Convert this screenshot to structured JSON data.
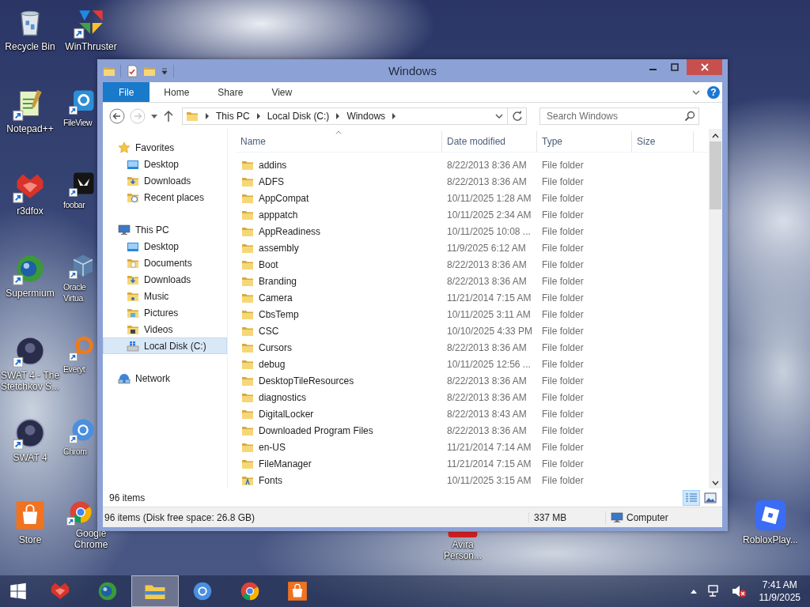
{
  "desktop": {
    "icons": [
      {
        "label": "Recycle Bin",
        "kind": "recycle",
        "shortcut": false
      },
      {
        "label": "Notepad++",
        "kind": "notepad",
        "shortcut": true
      },
      {
        "label": "r3dfox",
        "kind": "fox",
        "shortcut": true
      },
      {
        "label": "Supermium",
        "kind": "globe",
        "shortcut": true
      },
      {
        "label": "SWAT 4 - The Stetchkov S...",
        "kind": "portrait",
        "shortcut": true
      },
      {
        "label": "SWAT 4",
        "kind": "portrait",
        "shortcut": true
      },
      {
        "label": "Store",
        "kind": "store",
        "shortcut": false
      },
      {
        "label": "WinThruster",
        "kind": "winthruster",
        "shortcut": true
      },
      {
        "label": "FileView",
        "kind": "viewer",
        "shortcut": true
      },
      {
        "label": "foobar",
        "kind": "foobar",
        "shortcut": true
      },
      {
        "label": "Oracle Virtua",
        "kind": "cube",
        "shortcut": true
      },
      {
        "label": "Everyt",
        "kind": "magnifier",
        "shortcut": true
      },
      {
        "label": "Chrom",
        "kind": "chromium",
        "shortcut": true
      },
      {
        "label": "Google Chrome",
        "kind": "chrome",
        "shortcut": true
      },
      {
        "label": "Avira Person...",
        "kind": "avira",
        "shortcut": false
      },
      {
        "label": "RobloxPlay...",
        "kind": "roblox",
        "shortcut": false
      }
    ]
  },
  "window": {
    "title": "Windows",
    "ribbon": {
      "tabs": [
        {
          "label": "File",
          "kind": "menu"
        },
        {
          "label": "Home",
          "kind": "tab"
        },
        {
          "label": "Share",
          "kind": "tab"
        },
        {
          "label": "View",
          "kind": "tab"
        }
      ],
      "help": "?"
    },
    "navigation_buttons": [
      {
        "kind": "back",
        "disabled": false
      },
      {
        "kind": "forward",
        "disabled": true
      }
    ],
    "address": {
      "crumbs": [
        "This PC",
        "Local Disk (C:)",
        "Windows"
      ]
    },
    "search": {
      "placeholder": "Search Windows"
    },
    "nav": [
      {
        "label": "Favorites",
        "kind": "star",
        "selected": false,
        "children": [
          {
            "label": "Desktop",
            "kind": "desktop",
            "selected": false
          },
          {
            "label": "Downloads",
            "kind": "downloads",
            "selected": false
          },
          {
            "label": "Recent places",
            "kind": "recent",
            "selected": false
          }
        ]
      },
      {
        "label": "This PC",
        "kind": "pc",
        "selected": false,
        "children": [
          {
            "label": "Desktop",
            "kind": "desktop",
            "selected": false
          },
          {
            "label": "Documents",
            "kind": "documents",
            "selected": false
          },
          {
            "label": "Downloads",
            "kind": "downloads",
            "selected": false
          },
          {
            "label": "Music",
            "kind": "music",
            "selected": false
          },
          {
            "label": "Pictures",
            "kind": "pictures",
            "selected": false
          },
          {
            "label": "Videos",
            "kind": "videos",
            "selected": false
          },
          {
            "label": "Local Disk (C:)",
            "kind": "drive",
            "selected": true
          }
        ]
      },
      {
        "label": "Network",
        "kind": "network",
        "selected": false
      }
    ],
    "table": {
      "columns": [
        {
          "label": "Name",
          "sorted": true
        },
        {
          "label": "Date modified",
          "sorted": false
        },
        {
          "label": "Type",
          "sorted": false
        },
        {
          "label": "Size",
          "sorted": false
        }
      ],
      "rows": [
        {
          "name": "addins",
          "date": "8/22/2013 8:36 AM",
          "type": "File folder",
          "kind": "folder"
        },
        {
          "name": "ADFS",
          "date": "8/22/2013 8:36 AM",
          "type": "File folder",
          "kind": "folder"
        },
        {
          "name": "AppCompat",
          "date": "10/11/2025 1:28 AM",
          "type": "File folder",
          "kind": "folder"
        },
        {
          "name": "apppatch",
          "date": "10/11/2025 2:34 AM",
          "type": "File folder",
          "kind": "folder"
        },
        {
          "name": "AppReadiness",
          "date": "10/11/2025 10:08 ...",
          "type": "File folder",
          "kind": "folder"
        },
        {
          "name": "assembly",
          "date": "11/9/2025 6:12 AM",
          "type": "File folder",
          "kind": "folder"
        },
        {
          "name": "Boot",
          "date": "8/22/2013 8:36 AM",
          "type": "File folder",
          "kind": "folder"
        },
        {
          "name": "Branding",
          "date": "8/22/2013 8:36 AM",
          "type": "File folder",
          "kind": "folder"
        },
        {
          "name": "Camera",
          "date": "11/21/2014 7:15 AM",
          "type": "File folder",
          "kind": "folder"
        },
        {
          "name": "CbsTemp",
          "date": "10/11/2025 3:11 AM",
          "type": "File folder",
          "kind": "folder"
        },
        {
          "name": "CSC",
          "date": "10/10/2025 4:33 PM",
          "type": "File folder",
          "kind": "folder"
        },
        {
          "name": "Cursors",
          "date": "8/22/2013 8:36 AM",
          "type": "File folder",
          "kind": "folder"
        },
        {
          "name": "debug",
          "date": "10/11/2025 12:56 ...",
          "type": "File folder",
          "kind": "folder"
        },
        {
          "name": "DesktopTileResources",
          "date": "8/22/2013 8:36 AM",
          "type": "File folder",
          "kind": "folder"
        },
        {
          "name": "diagnostics",
          "date": "8/22/2013 8:36 AM",
          "type": "File folder",
          "kind": "folder"
        },
        {
          "name": "DigitalLocker",
          "date": "8/22/2013 8:43 AM",
          "type": "File folder",
          "kind": "folder"
        },
        {
          "name": "Downloaded Program Files",
          "date": "8/22/2013 8:36 AM",
          "type": "File folder",
          "kind": "folder"
        },
        {
          "name": "en-US",
          "date": "11/21/2014 7:14 AM",
          "type": "File folder",
          "kind": "folder"
        },
        {
          "name": "FileManager",
          "date": "11/21/2014 7:15 AM",
          "type": "File folder",
          "kind": "folder"
        },
        {
          "name": "Fonts",
          "date": "10/11/2025 3:15 AM",
          "type": "File folder",
          "kind": "fonts"
        }
      ]
    },
    "item_count": "96 items",
    "view_buttons": [
      {
        "kind": "details",
        "selected": true
      },
      {
        "kind": "tiles",
        "selected": false
      }
    ],
    "status_bar": {
      "summary": "96 items (Disk free space: 26.8 GB)",
      "size": "337 MB",
      "location": "Computer"
    }
  },
  "taskbar": {
    "apps": [
      {
        "kind": "fox",
        "selected": false
      },
      {
        "kind": "globe",
        "selected": false
      },
      {
        "kind": "explorer",
        "selected": true
      },
      {
        "kind": "chromium",
        "selected": false
      },
      {
        "kind": "chrome",
        "selected": false
      },
      {
        "kind": "store",
        "selected": false
      }
    ],
    "time": "7:41 AM",
    "date": "11/9/2025"
  }
}
